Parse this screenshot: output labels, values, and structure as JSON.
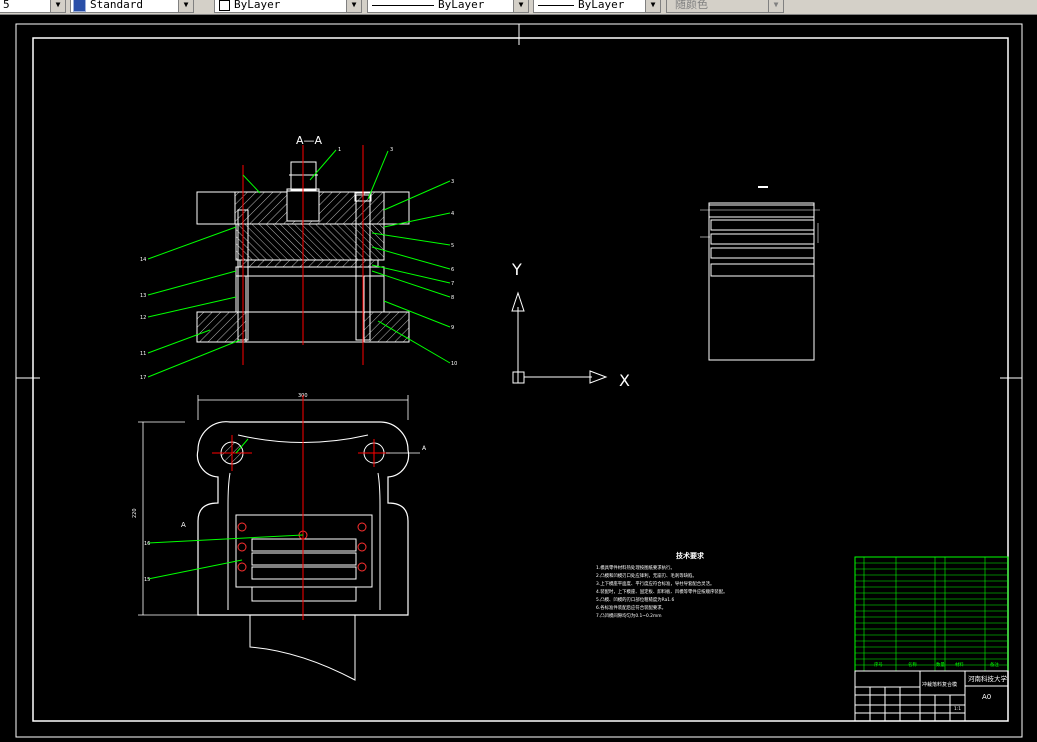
{
  "toolbar": {
    "left_cut": "5",
    "text_style": "Standard",
    "layer": "ByLayer",
    "linetype": "ByLayer",
    "lineweight": "ByLayer",
    "plot_style": "随颜色"
  },
  "drawing": {
    "section_label": "A—A",
    "section_mark": "A",
    "view_mark": "A",
    "tech_title": "技术要求",
    "tech_lines": [
      "1.模具零件材料热处理按图纸要求执行。",
      "2.凸模和凹模刃口处应锋利，无崩刃、毛刺等缺陷。",
      "3.上下模座平面度、平行度应符合标准，导柱导套配合灵活。",
      "4.装配时，上下模座、固定板、卸料板、凹模等零件应按顺序装配。",
      "5.凸模、凹模的刃口部位粗糙度为Ra1.6",
      "6.各标准件装配后应符合装配要求。",
      "7.凸凹模间隙均匀为0.1~0.2mm"
    ],
    "ucs_y": "Y",
    "ucs_x": "X",
    "dim_width": "300",
    "dim_height": "220",
    "title_block": {
      "school": "河南科技大学",
      "drawing_name": "冲裁落料复合模",
      "size": "A0",
      "scale": "1:1",
      "col_seq": "序号",
      "col_name": "名称",
      "col_qty": "数量",
      "col_material": "材料",
      "col_note": "备注"
    },
    "balloons": [
      "1",
      "2",
      "3",
      "4",
      "5",
      "6",
      "7",
      "8",
      "9",
      "10",
      "11",
      "12",
      "13",
      "14",
      "15",
      "16",
      "17"
    ]
  },
  "colors": {
    "background": "#000000",
    "line": "#ffffff",
    "leader": "#00ff00",
    "centerline": "#ff0000",
    "hatch": "#c0c0c0",
    "toolbar": "#d4d0c8"
  }
}
